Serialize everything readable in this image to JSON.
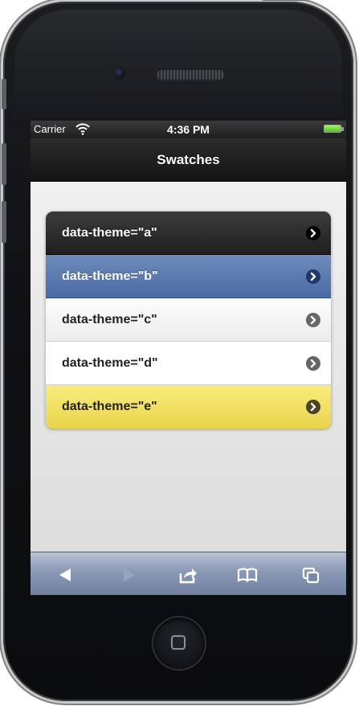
{
  "status_bar": {
    "carrier": "Carrier",
    "time": "4:36 PM",
    "signal_icon": "wifi-icon",
    "battery_icon": "battery-icon"
  },
  "header": {
    "title": "Swatches"
  },
  "listview": {
    "items": [
      {
        "label": "data-theme=\"a\"",
        "icon": "chevron-right-icon",
        "theme_color": "#2a2a2a"
      },
      {
        "label": "data-theme=\"b\"",
        "icon": "chevron-right-icon",
        "theme_color": "#5777ad"
      },
      {
        "label": "data-theme=\"c\"",
        "icon": "chevron-right-icon",
        "theme_color": "#f6f6f6"
      },
      {
        "label": "data-theme=\"d\"",
        "icon": "chevron-right-icon",
        "theme_color": "#ffffff"
      },
      {
        "label": "data-theme=\"e\"",
        "icon": "chevron-right-icon",
        "theme_color": "#f1e05f"
      }
    ]
  },
  "toolbar": {
    "buttons": [
      {
        "icon": "back-arrow-icon",
        "enabled": true
      },
      {
        "icon": "forward-arrow-icon",
        "enabled": false
      },
      {
        "icon": "share-icon",
        "enabled": true
      },
      {
        "icon": "bookmarks-icon",
        "enabled": true
      },
      {
        "icon": "pages-icon",
        "enabled": true
      }
    ]
  },
  "device": {
    "home_button_icon": "home-square-icon"
  }
}
